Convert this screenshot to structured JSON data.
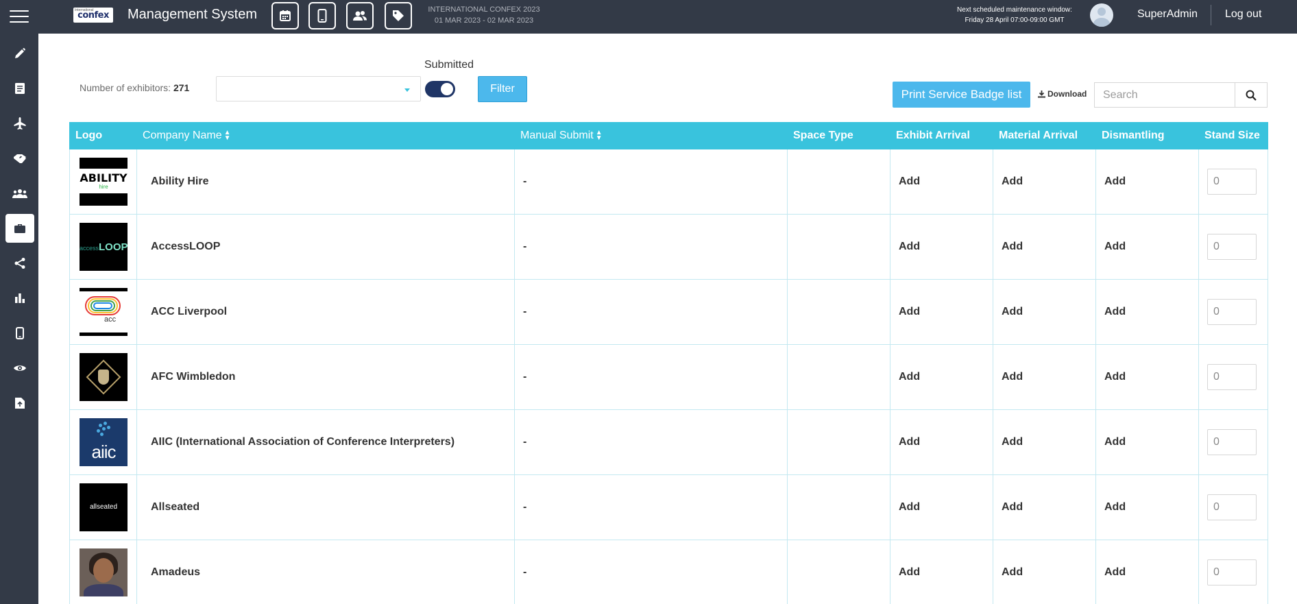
{
  "header": {
    "logo_text": "confex",
    "logo_small_text": "International",
    "title": "Management System",
    "toolbar_icons": [
      "calendar-icon",
      "mobile-icon",
      "users-icon",
      "tag-icon"
    ],
    "event_name": "INTERNATIONAL CONFEX 2023",
    "event_dates": "01 MAR 2023 - 02 MAR 2023",
    "maintenance_title": "Next scheduled maintenance window:",
    "maintenance_time": "Friday 28 April 07:00-09:00 GMT",
    "username": "SuperAdmin",
    "logout_label": "Log out"
  },
  "sidebar": {
    "items": [
      {
        "icon": "pencil-icon"
      },
      {
        "icon": "document-icon"
      },
      {
        "icon": "airplane-icon"
      },
      {
        "icon": "handshake-icon"
      },
      {
        "icon": "people-icon"
      },
      {
        "icon": "briefcase-icon",
        "active": true
      },
      {
        "icon": "share-icon"
      },
      {
        "icon": "bar-chart-icon"
      },
      {
        "icon": "mobile-icon"
      },
      {
        "icon": "eye-icon"
      },
      {
        "icon": "file-upload-icon"
      }
    ]
  },
  "toolbar": {
    "exhibitor_count_label": "Number of exhibitors:",
    "exhibitor_count": "271",
    "select_value": "",
    "submitted_label": "Submitted",
    "submitted_on": true,
    "filter_label": "Filter",
    "print_label": "Print Service Badge list",
    "download_label": "Download",
    "search_placeholder": "Search",
    "search_value": ""
  },
  "table": {
    "columns": [
      "Logo",
      "Company Name",
      "Manual Submit",
      "Space Type",
      "Exhibit Arrival",
      "Material Arrival",
      "Dismantling",
      "Stand Size"
    ],
    "rows": [
      {
        "logo": "ability-hire-logo",
        "logo_text": "ABILITY",
        "logo_sub": "hire",
        "company": "Ability Hire",
        "manual_submit": "-",
        "space_type": "",
        "exhibit_arrival": "Add",
        "material_arrival": "Add",
        "dismantling": "Add",
        "stand_size": "0"
      },
      {
        "logo": "accessloop-logo",
        "logo_text": "access",
        "logo_sub": "LOOP",
        "company": "AccessLOOP",
        "manual_submit": "-",
        "space_type": "",
        "exhibit_arrival": "Add",
        "material_arrival": "Add",
        "dismantling": "Add",
        "stand_size": "0"
      },
      {
        "logo": "acc-liverpool-logo",
        "logo_text": "acc",
        "logo_sub": "",
        "company": "ACC Liverpool",
        "manual_submit": "-",
        "space_type": "",
        "exhibit_arrival": "Add",
        "material_arrival": "Add",
        "dismantling": "Add",
        "stand_size": "0"
      },
      {
        "logo": "afc-wimbledon-logo",
        "logo_text": "",
        "logo_sub": "",
        "company": "AFC Wimbledon",
        "manual_submit": "-",
        "space_type": "",
        "exhibit_arrival": "Add",
        "material_arrival": "Add",
        "dismantling": "Add",
        "stand_size": "0"
      },
      {
        "logo": "aiic-logo",
        "logo_text": "aiic",
        "logo_sub": "",
        "company": "AIIC (International Association of Conference Interpreters)",
        "manual_submit": "-",
        "space_type": "",
        "exhibit_arrival": "Add",
        "material_arrival": "Add",
        "dismantling": "Add",
        "stand_size": "0"
      },
      {
        "logo": "allseated-logo",
        "logo_text": "allseated",
        "logo_sub": "",
        "company": "Allseated",
        "manual_submit": "-",
        "space_type": "",
        "exhibit_arrival": "Add",
        "material_arrival": "Add",
        "dismantling": "Add",
        "stand_size": "0"
      },
      {
        "logo": "amadeus-photo",
        "logo_text": "",
        "logo_sub": "",
        "company": "Amadeus",
        "manual_submit": "-",
        "space_type": "",
        "exhibit_arrival": "Add",
        "material_arrival": "Add",
        "dismantling": "Add",
        "stand_size": "0"
      }
    ]
  },
  "colors": {
    "topbar": "#333a47",
    "accent": "#39c3dd",
    "button": "#4cb8ec",
    "toggle": "#1f3566"
  }
}
